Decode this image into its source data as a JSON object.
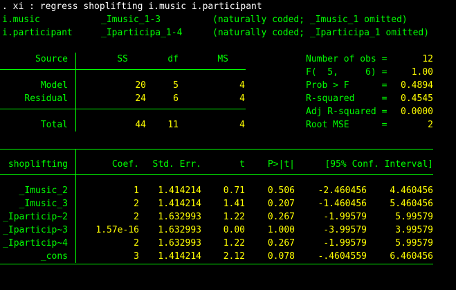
{
  "command": ". xi : regress shoplifting i.music i.participant",
  "xi_lines": [
    {
      "var": "i.music",
      "dummy": "_Imusic_1-3",
      "note": "(naturally coded; _Imusic_1 omitted)"
    },
    {
      "var": "i.participant",
      "dummy": "_Iparticipa_1-4",
      "note": "(naturally coded; _Iparticipa_1 omitted)"
    }
  ],
  "anova": {
    "headers": {
      "source": "Source",
      "ss": "SS",
      "df": "df",
      "ms": "MS"
    },
    "rows": [
      {
        "source": "Model",
        "ss": "20",
        "df": "5",
        "ms": "4"
      },
      {
        "source": "Residual",
        "ss": "24",
        "df": "6",
        "ms": "4"
      }
    ],
    "total": {
      "source": "Total",
      "ss": "44",
      "df": "11",
      "ms": "4"
    }
  },
  "stats": [
    {
      "label": "Number of obs =",
      "value": "12"
    },
    {
      "label": "F(  5,     6) =",
      "value": "1.00"
    },
    {
      "label": "Prob > F      =",
      "value": "0.4894"
    },
    {
      "label": "R-squared     =",
      "value": "0.4545"
    },
    {
      "label": "Adj R-squared =",
      "value": "0.0000"
    },
    {
      "label": "Root MSE      =",
      "value": "2"
    }
  ],
  "coef": {
    "headers": {
      "depvar": "shoplifting",
      "coef": "Coef.",
      "se": "Std. Err.",
      "t": "t",
      "p": "P>|t|",
      "ci": "[95% Conf. Interval]"
    },
    "rows": [
      {
        "var": "_Imusic_2",
        "coef": "1",
        "se": "1.414214",
        "t": "0.71",
        "p": "0.506",
        "lo": "-2.460456",
        "hi": "4.460456"
      },
      {
        "var": "_Imusic_3",
        "coef": "2",
        "se": "1.414214",
        "t": "1.41",
        "p": "0.207",
        "lo": "-1.460456",
        "hi": "5.460456"
      },
      {
        "var": "_Iparticip~2",
        "coef": "2",
        "se": "1.632993",
        "t": "1.22",
        "p": "0.267",
        "lo": "-1.99579",
        "hi": "5.99579"
      },
      {
        "var": "_Iparticip~3",
        "coef": "1.57e-16",
        "se": "1.632993",
        "t": "0.00",
        "p": "1.000",
        "lo": "-3.99579",
        "hi": "3.99579"
      },
      {
        "var": "_Iparticip~4",
        "coef": "2",
        "se": "1.632993",
        "t": "1.22",
        "p": "0.267",
        "lo": "-1.99579",
        "hi": "5.99579"
      },
      {
        "var": "_cons",
        "coef": "3",
        "se": "1.414214",
        "t": "2.12",
        "p": "0.078",
        "lo": "-.4604559",
        "hi": "6.460456"
      }
    ]
  },
  "colors": {
    "background": "#000000",
    "text": "#ffffff",
    "label": "#00ff00",
    "value": "#ffff00"
  }
}
